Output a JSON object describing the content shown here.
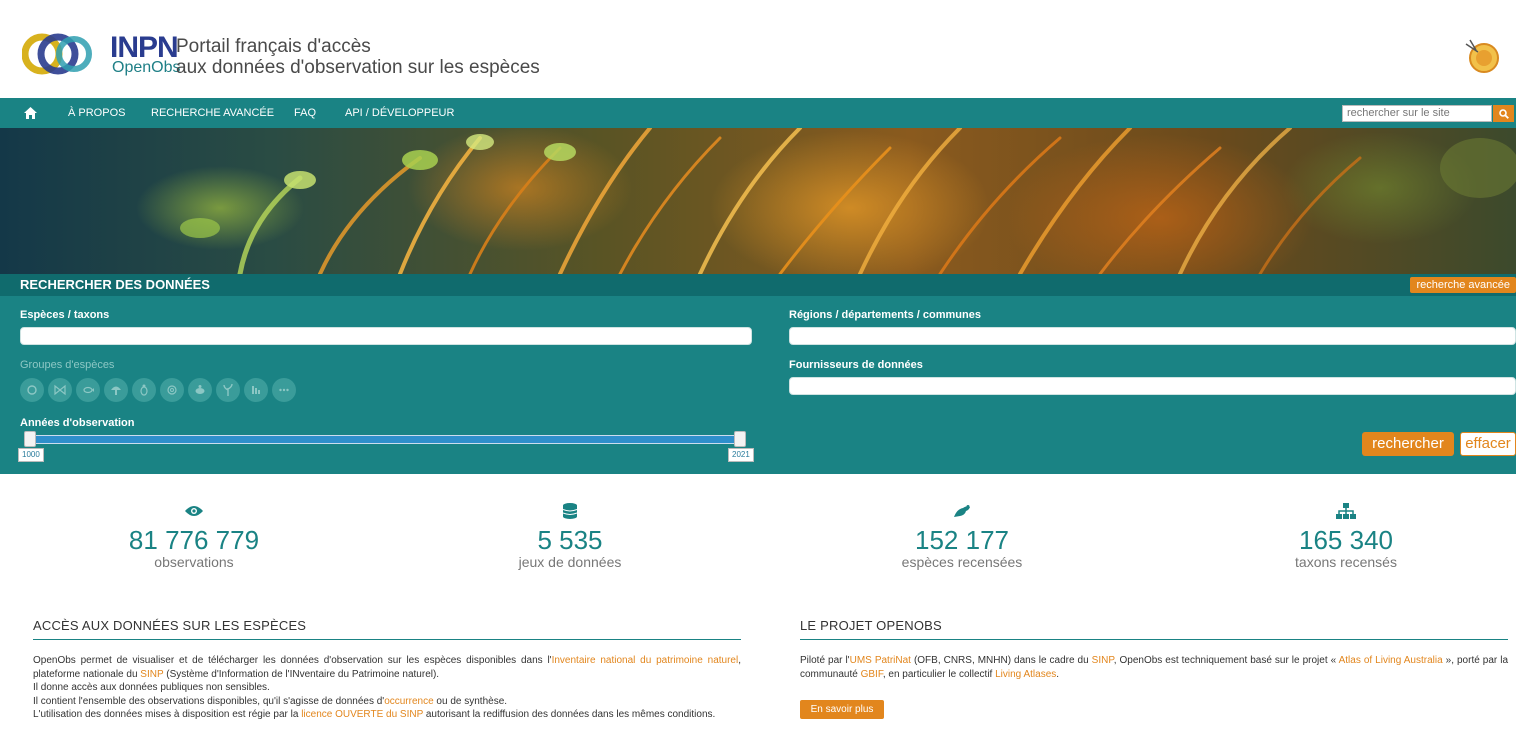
{
  "header": {
    "logo_text": "INPN",
    "logo_sub": "OpenObs",
    "tagline_line1": "Portail français d'accès",
    "tagline_line2": "aux données d'observation sur les espèces"
  },
  "nav": {
    "items": [
      "À PROPOS",
      "RECHERCHE AVANCÉE",
      "FAQ",
      "API / DÉVELOPPEUR"
    ],
    "search_placeholder": "rechercher sur le site"
  },
  "search_panel": {
    "title": "RECHERCHER DES DONNÉES",
    "advanced_button": "recherche avancée",
    "species_label": "Espèces / taxons",
    "regions_label": "Régions / départements / communes",
    "groups_label": "Groupes d'espèces",
    "providers_label": "Fournisseurs de données",
    "years_label": "Années d'observation",
    "year_min": "1000",
    "year_max": "2021",
    "search_button": "rechercher",
    "clear_button": "effacer",
    "group_icons": [
      "amphibian-icon",
      "butterfly-icon",
      "fish-icon",
      "mushroom-icon",
      "insect-icon",
      "snail-icon",
      "turtle-icon",
      "plant-icon",
      "bird-icon",
      "more-icon"
    ]
  },
  "stats": [
    {
      "icon": "eye-icon",
      "value": "81 776 779",
      "label": "observations"
    },
    {
      "icon": "database-icon",
      "value": "5 535",
      "label": "jeux de données"
    },
    {
      "icon": "frog-icon",
      "value": "152 177",
      "label": "espèces recensées"
    },
    {
      "icon": "sitemap-icon",
      "value": "165 340",
      "label": "taxons recensés"
    }
  ],
  "section_access": {
    "title": "ACCÈS AUX DONNÉES SUR LES ESPÈCES",
    "p1_a": "OpenObs permet de visualiser et de télécharger les données d'observation sur les espèces disponibles dans l'",
    "p1_link1": "Inventaire national du patrimoine naturel",
    "p1_b": ", plateforme nationale du ",
    "p1_link2": "SINP",
    "p1_c": " (Système d'Information de l'INventaire du Patrimoine naturel).",
    "p2": "Il donne accès aux données publiques non sensibles.",
    "p3_a": "Il contient l'ensemble des observations disponibles, qu'il s'agisse de données d'",
    "p3_link": "occurrence",
    "p3_b": " ou de synthèse.",
    "p4_a": "L'utilisation des données mises à disposition est régie par la ",
    "p4_link": "licence OUVERTE du SINP",
    "p4_b": " autorisant la rediffusion des données dans les mêmes conditions."
  },
  "section_project": {
    "title": "LE PROJET OPENOBS",
    "a": "Piloté par l'",
    "link1": "UMS PatriNat",
    "b": " (OFB, CNRS, MNHN) dans le cadre du ",
    "link2": "SINP",
    "c": ", OpenObs est techniquement basé sur le projet « ",
    "link3": "Atlas of Living Australia",
    "d": " », porté par la communauté ",
    "link4": "GBIF",
    "e": ", en particulier le collectif ",
    "link5": "Living Atlases",
    "f": ".",
    "more_button": "En savoir plus"
  },
  "colors": {
    "teal": "#1a8384",
    "orange": "#e2861d"
  }
}
